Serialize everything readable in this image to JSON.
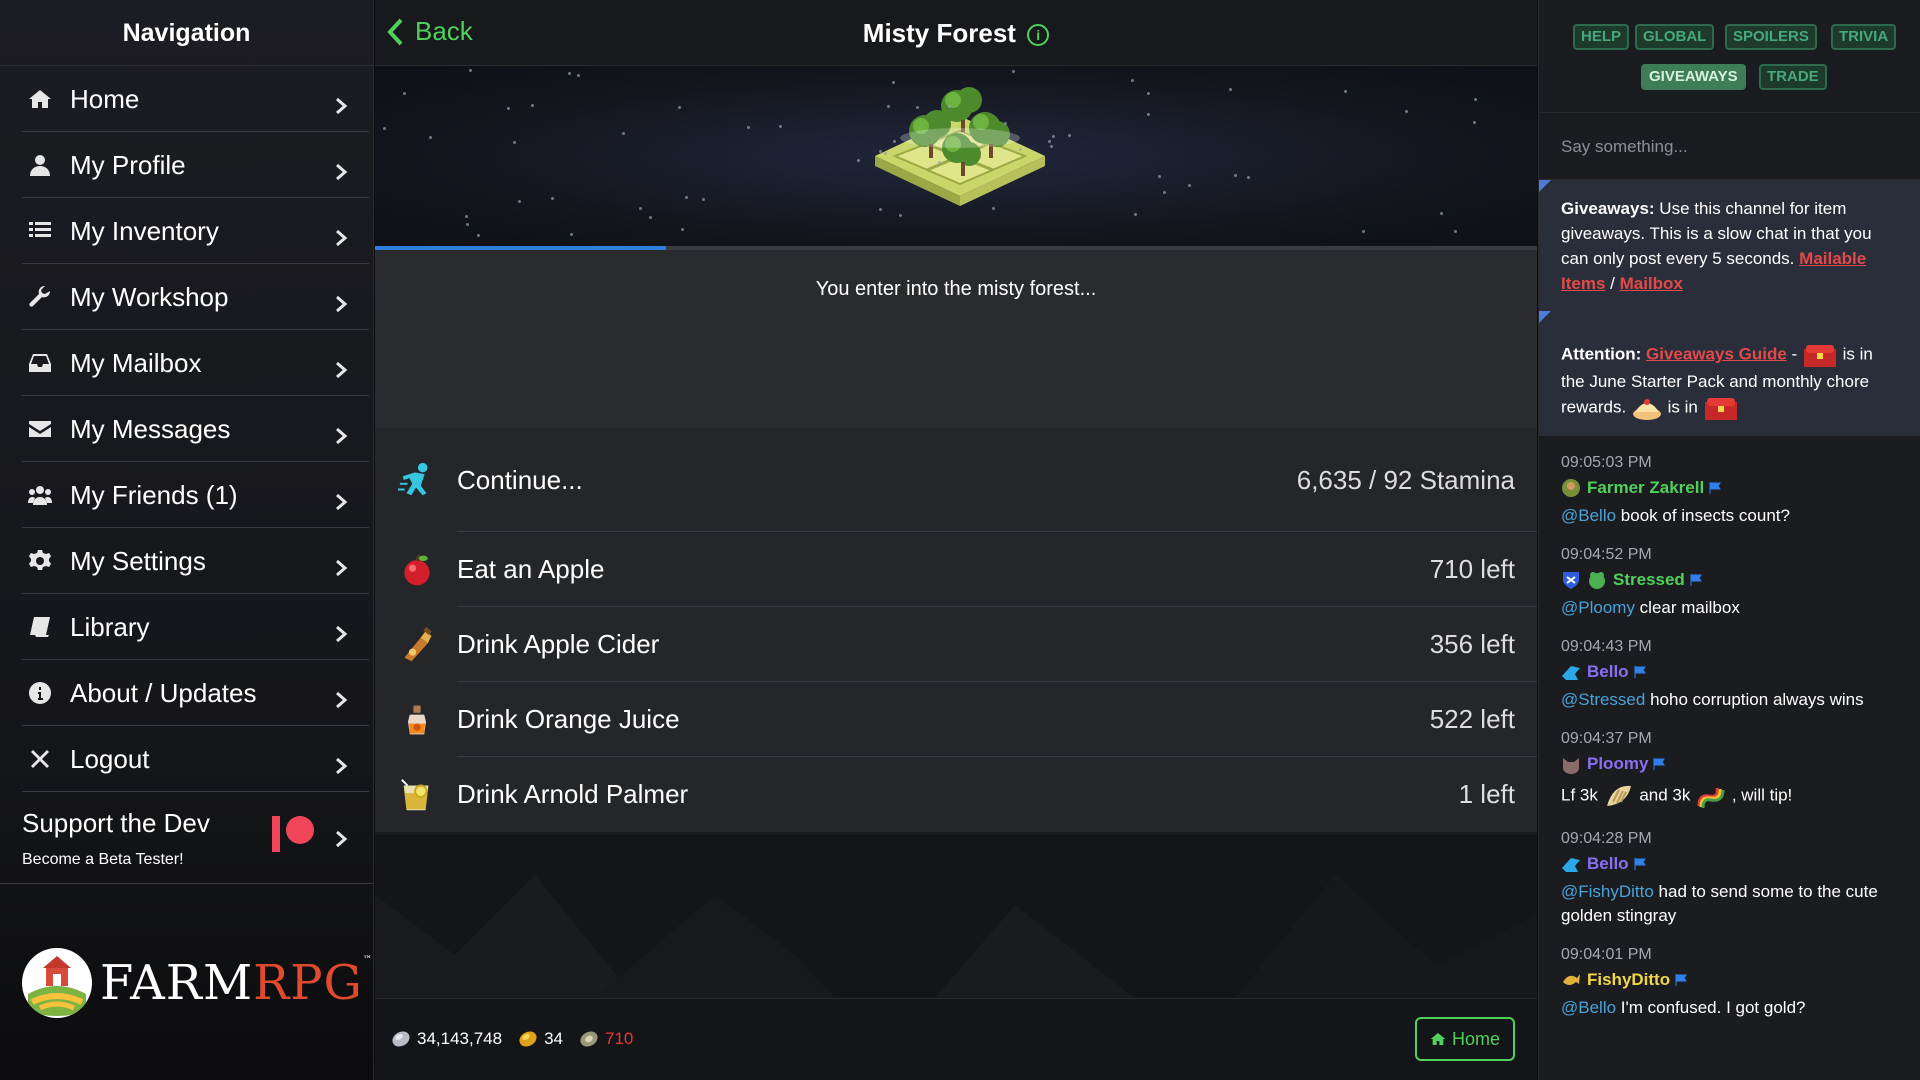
{
  "nav": {
    "title": "Navigation",
    "items": [
      {
        "label": "Home"
      },
      {
        "label": "My Profile"
      },
      {
        "label": "My Inventory"
      },
      {
        "label": "My Workshop"
      },
      {
        "label": "My Mailbox"
      },
      {
        "label": "My Messages"
      },
      {
        "label": "My Friends (1)"
      },
      {
        "label": "My Settings"
      },
      {
        "label": "Library"
      },
      {
        "label": "About / Updates"
      },
      {
        "label": "Logout"
      }
    ],
    "support": {
      "title": "Support the Dev",
      "subtitle": "Become a Beta Tester!"
    },
    "logo": {
      "farm": "FARM",
      "rpg": "RPG",
      "tm": "™"
    }
  },
  "header": {
    "back": "Back",
    "title": "Misty Forest"
  },
  "explore": {
    "progress_fraction": 0.25,
    "message": "You enter into the misty forest...",
    "actions": [
      {
        "label": "Continue...",
        "right": "6,635  / 92 Stamina"
      },
      {
        "label": "Eat an Apple",
        "right": "710 left"
      },
      {
        "label": "Drink Apple Cider",
        "right": "356 left"
      },
      {
        "label": "Drink Orange Juice",
        "right": "522 left"
      },
      {
        "label": "Drink Arnold Palmer",
        "right": "1 left"
      }
    ]
  },
  "footer": {
    "silver": "34,143,748",
    "gold": "34",
    "apples": "710",
    "home": "Home"
  },
  "chat": {
    "tabs": [
      "HELP",
      "GLOBAL",
      "SPOILERS",
      "TRIVIA",
      "GIVEAWAYS",
      "TRADE"
    ],
    "active_tab": "GIVEAWAYS",
    "input_placeholder": "Say something...",
    "notice1": {
      "bold": "Giveaways:",
      "text": " Use this channel for item giveaways. This is a slow chat in that you can only post every 5 seconds.",
      "link1": "Mailable Items",
      "sep": " / ",
      "link2": "Mailbox"
    },
    "notice2": {
      "bold": "Attention:",
      "link": "Giveaways Guide",
      "dash": " - ",
      "t1": " is in the June Starter Pack and monthly chore rewards. ",
      "t2": " is in "
    },
    "messages": [
      {
        "time": "09:05:03 PM",
        "user": "Farmer Zakrell",
        "mention": "@Bello",
        "text": " book of insects count?"
      },
      {
        "time": "09:04:52 PM",
        "user": "Stressed",
        "mention": "@Ploomy",
        "text": " clear mailbox"
      },
      {
        "time": "09:04:43 PM",
        "user": "Bello",
        "mention": "@Stressed",
        "text": " hoho corruption always wins"
      },
      {
        "time": "09:04:37 PM",
        "user": "Ploomy",
        "t1": "Lf 3k ",
        "t2": " and 3k ",
        "t3": " , will tip!"
      },
      {
        "time": "09:04:28 PM",
        "user": "Bello",
        "mention": "@FishyDitto",
        "text": " had to send some to the cute golden stingray"
      },
      {
        "time": "09:04:01 PM",
        "user": "FishyDitto",
        "mention": "@Bello",
        "text": " I'm confused. I got gold?"
      }
    ]
  },
  "colors": {
    "accent_green": "#4fd15b",
    "link_red": "#e24a4a",
    "mention_blue": "#4aa3d8",
    "progress_blue": "#2e7fe0"
  }
}
